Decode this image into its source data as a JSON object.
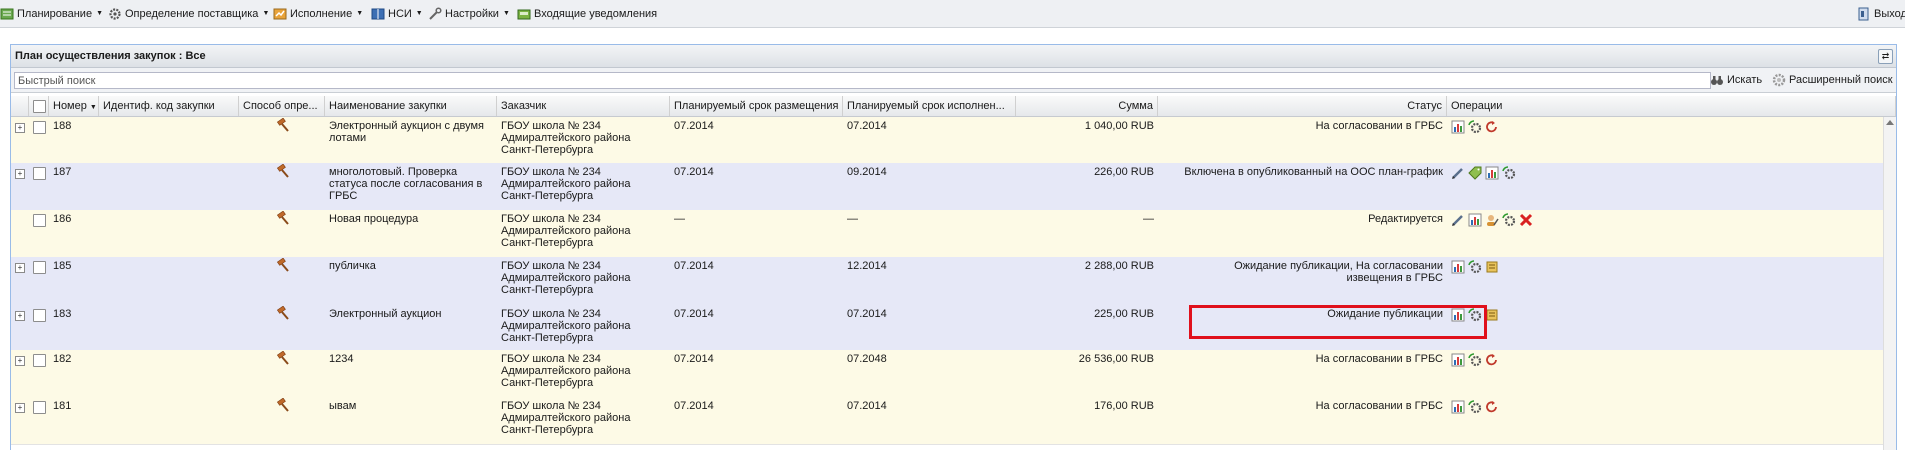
{
  "menu": {
    "items": [
      {
        "label": "Планирование",
        "icon": "planning-icon"
      },
      {
        "label": "Определение поставщика",
        "icon": "supplier-gear-icon"
      },
      {
        "label": "Исполнение",
        "icon": "execution-icon"
      },
      {
        "label": "НСИ",
        "icon": "reference-book-icon"
      },
      {
        "label": "Настройки",
        "icon": "wrench-icon"
      },
      {
        "label": "Входящие уведомления",
        "icon": "inbox-icon"
      }
    ],
    "exit_label": "Выход"
  },
  "panel": {
    "title": "План осуществления закупок : Все"
  },
  "search": {
    "placeholder": "Быстрый поиск",
    "search_label": "Искать",
    "advanced_label": "Расширенный поиск"
  },
  "columns": {
    "number": "Номер",
    "ident": "Идентиф. код закупки",
    "method": "Способ опре...",
    "name": "Наименование закупки",
    "customer": "Заказчик",
    "place_date": "Планируемый срок размещения",
    "exec_date": "Планируемый срок исполнен...",
    "sum": "Сумма",
    "status": "Статус",
    "operations": "Операции"
  },
  "rows": [
    {
      "number": "188",
      "name": "Электронный аукцион с двумя лотами",
      "customer": "ГБОУ школа № 234 Адмиралтейского района Санкт-Петербурга",
      "place_date": "07.2014",
      "exec_date": "07.2014",
      "sum": "1 040,00 RUB",
      "status": "На согласовании в ГРБС",
      "ops": [
        "chart-icon",
        "gear-arrows-icon",
        "refresh-icon"
      ],
      "expandable": true,
      "bg": "#fdfae6"
    },
    {
      "number": "187",
      "name": "многолотовый. Проверка статуса после согласования в ГРБС",
      "customer": "ГБОУ школа № 234 Адмиралтейского района Санкт-Петербурга",
      "place_date": "07.2014",
      "exec_date": "09.2014",
      "sum": "226,00 RUB",
      "status": "Включена в опубликованный на ООС план-график",
      "ops": [
        "edit-pencil-icon",
        "tag-icon",
        "chart-icon",
        "gear-arrows-icon"
      ],
      "expandable": true,
      "bg": "#e6e8f7"
    },
    {
      "number": "186",
      "name": "Новая процедура",
      "customer": "ГБОУ школа № 234 Адмиралтейского района Санкт-Петербурга",
      "place_date": "—",
      "exec_date": "—",
      "sum": "—",
      "status": "Редактируется",
      "ops": [
        "edit-pencil-icon",
        "chart-icon",
        "user-edit-icon",
        "gear-arrows-icon",
        "delete-x-icon"
      ],
      "expandable": false,
      "bg": "#fdfae6"
    },
    {
      "number": "185",
      "name": "публичка",
      "customer": "ГБОУ школа № 234 Адмиралтейского района Санкт-Петербурга",
      "place_date": "07.2014",
      "exec_date": "12.2014",
      "sum": "2 288,00 RUB",
      "status": "Ожидание публикации, На согласовании извещения в ГРБС",
      "ops": [
        "chart-icon",
        "gear-arrows-icon",
        "scroll-icon"
      ],
      "expandable": true,
      "bg": "#e6e8f7"
    },
    {
      "number": "183",
      "name": "Электронный аукцион",
      "customer": "ГБОУ школа № 234 Адмиралтейского района Санкт-Петербурга",
      "place_date": "07.2014",
      "exec_date": "07.2014",
      "sum": "225,00 RUB",
      "status": "Ожидание публикации",
      "ops": [
        "chart-icon",
        "gear-arrows-icon",
        "scroll-icon"
      ],
      "expandable": true,
      "bg": "#e6e8f7"
    },
    {
      "number": "182",
      "name": "1234",
      "customer": "ГБОУ школа № 234 Адмиралтейского района Санкт-Петербурга",
      "place_date": "07.2014",
      "exec_date": "07.2048",
      "sum": "26 536,00 RUB",
      "status": "На согласовании в ГРБС",
      "ops": [
        "chart-icon",
        "gear-arrows-icon",
        "refresh-icon"
      ],
      "expandable": true,
      "bg": "#fdfae6"
    },
    {
      "number": "181",
      "name": "ывам",
      "customer": "ГБОУ школа № 234 Адмиралтейского района Санкт-Петербурга",
      "place_date": "07.2014",
      "exec_date": "07.2014",
      "sum": "176,00 RUB",
      "status": "На согласовании в ГРБС",
      "ops": [
        "chart-icon",
        "gear-arrows-icon",
        "refresh-icon"
      ],
      "expandable": true,
      "bg": "#fdfae6"
    }
  ]
}
